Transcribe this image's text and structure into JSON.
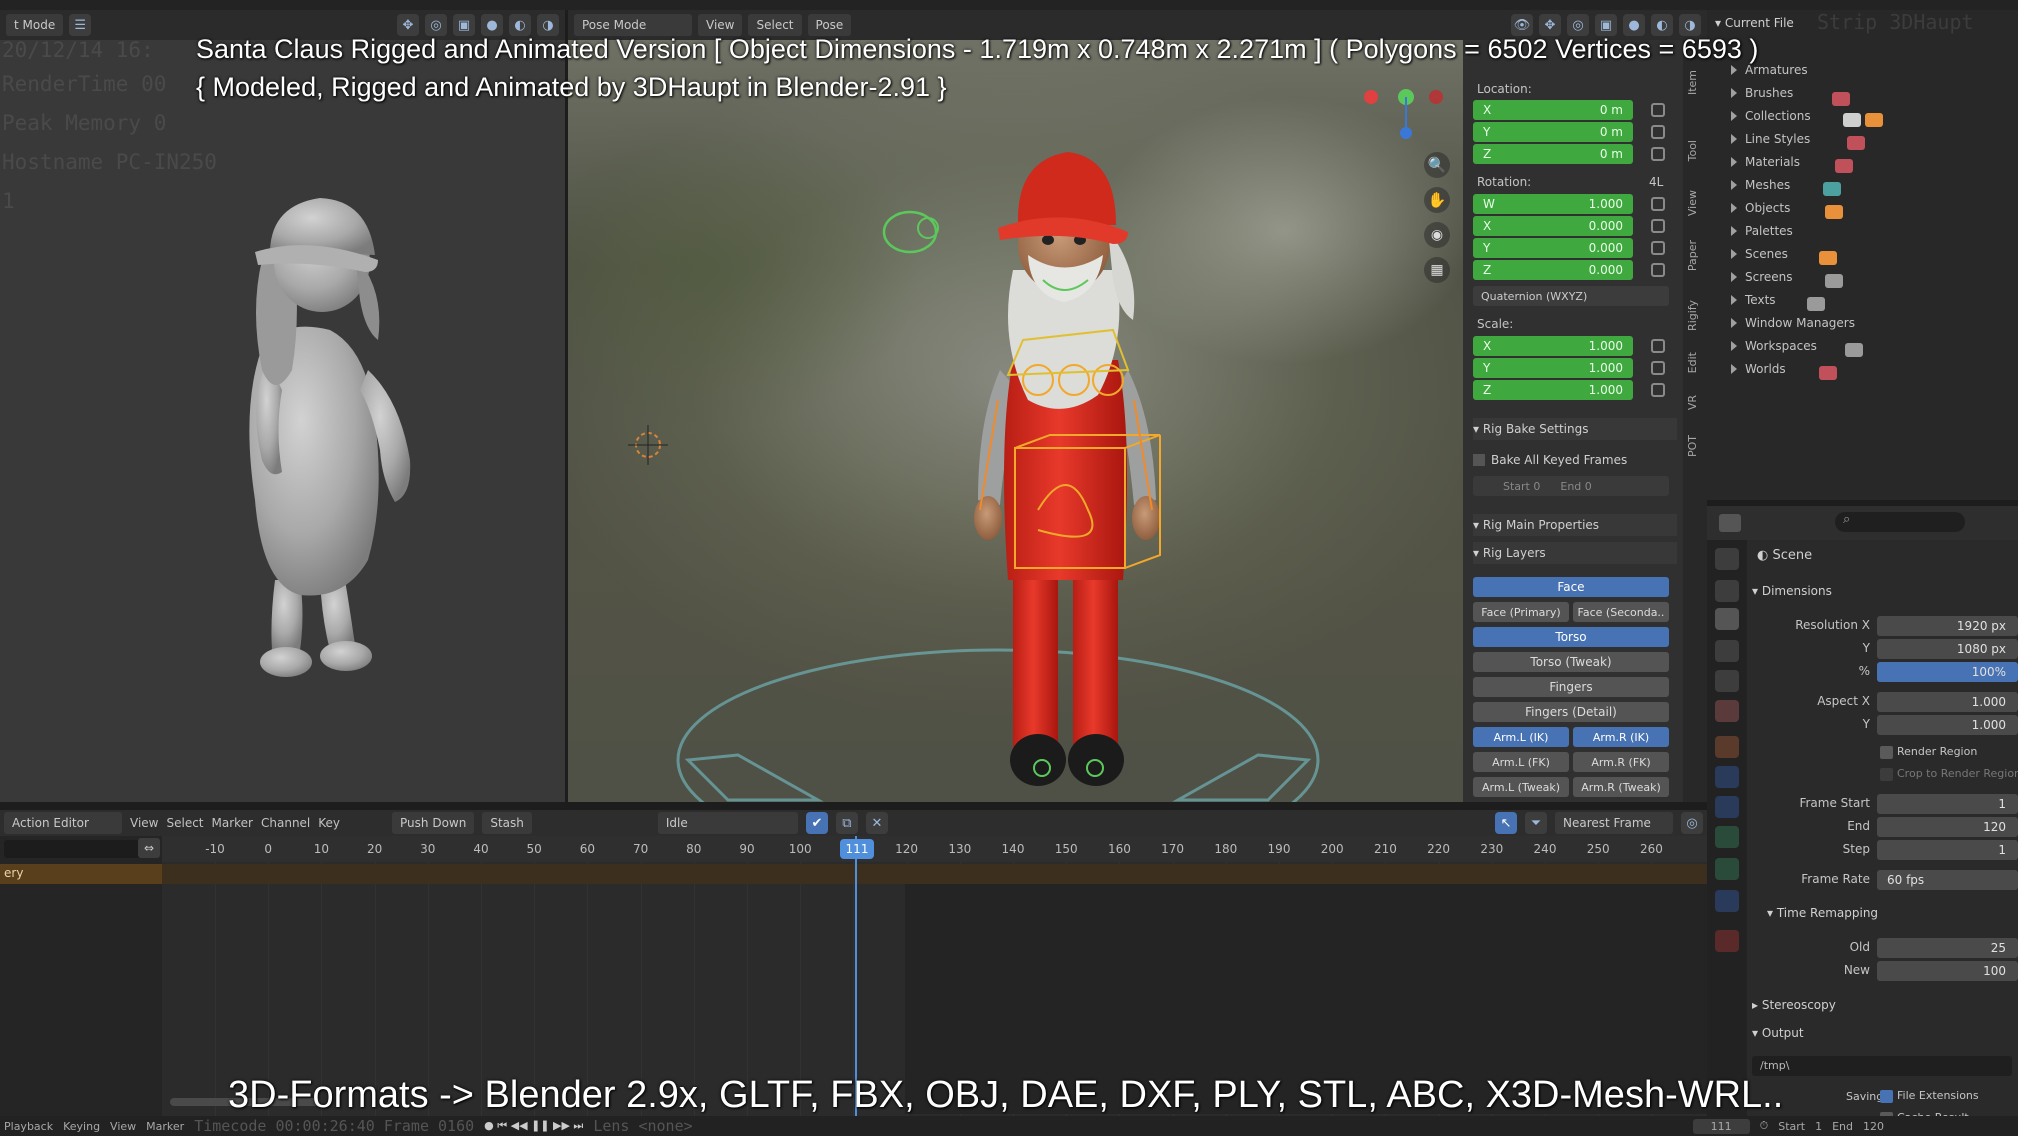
{
  "captions": {
    "title_line": "Santa Claus Rigged and Animated Version [ Object Dimensions -  1.719m x 0.748m x 2.271m ] ( Polygons = 6502  Vertices = 6593 )",
    "credit_line": "{ Modeled, Rigged and Animated by 3DHaupt in Blender-2.91 }",
    "formats_line": "3D-Formats -> Blender 2.9x, GLTF, FBX, OBJ, DAE, DXF, PLY, STL, ABC, X3D-Mesh-WRL.."
  },
  "left_view": {
    "mode_label": "t Mode",
    "stamp_lines": [
      "20/12/14 16:",
      "RenderTime 00",
      "Peak Memory 0",
      "Hostname PC-IN250",
      "1"
    ],
    "timecode": "Timecode 00:00:26:40   Frame 0160"
  },
  "viewport_header": {
    "mode": "Pose Mode",
    "menu": [
      "View",
      "Select",
      "Pose"
    ]
  },
  "npanel": {
    "location_label": "Location:",
    "location": [
      {
        "axis": "X",
        "value": "0 m"
      },
      {
        "axis": "Y",
        "value": "0 m"
      },
      {
        "axis": "Z",
        "value": "0 m"
      }
    ],
    "rotation_label": "Rotation:",
    "rotation_mode_short": "4L",
    "rotation": [
      {
        "axis": "W",
        "value": "1.000"
      },
      {
        "axis": "X",
        "value": "0.000"
      },
      {
        "axis": "Y",
        "value": "0.000"
      },
      {
        "axis": "Z",
        "value": "0.000"
      }
    ],
    "rotation_mode": "Quaternion (WXYZ)",
    "scale_label": "Scale:",
    "scale": [
      {
        "axis": "X",
        "value": "1.000"
      },
      {
        "axis": "Y",
        "value": "1.000"
      },
      {
        "axis": "Z",
        "value": "1.000"
      }
    ],
    "rig_bake": "Rig Bake Settings",
    "bake_all": "Bake All Keyed Frames",
    "bake_start": "Start   0",
    "bake_end": "End   0",
    "rig_main": "Rig Main Properties",
    "rig_layers": "Rig Layers",
    "layers": {
      "face": "Face",
      "face_primary": "Face (Primary)",
      "face_secondary": "Face (Seconda..",
      "torso": "Torso",
      "torso_tweak": "Torso (Tweak)",
      "fingers": "Fingers",
      "fingers_detail": "Fingers (Detail)",
      "arm_l_ik": "Arm.L (IK)",
      "arm_r_ik": "Arm.R (IK)",
      "arm_l_fk": "Arm.L (FK)",
      "arm_r_fk": "Arm.R (FK)",
      "arm_l_tweak": "Arm.L (Tweak)",
      "arm_r_tweak": "Arm.R (Tweak)"
    },
    "tabs": [
      "Item",
      "Tool",
      "View",
      "Paper",
      "Rigify",
      "Edit",
      "VR",
      "POT"
    ]
  },
  "outliner": {
    "header": "Current File",
    "ghost": "Strip 3DHaupt",
    "items": [
      "Armatures",
      "Brushes",
      "Collections",
      "Line Styles",
      "Materials",
      "Meshes",
      "Objects",
      "Palettes",
      "Scenes",
      "Screens",
      "Texts",
      "Window Managers",
      "Workspaces",
      "Worlds"
    ]
  },
  "properties": {
    "scene": "Scene",
    "dimensions": "Dimensions",
    "resolution_x_label": "Resolution X",
    "resolution_x": "1920 px",
    "y_label": "Y",
    "resolution_y": "1080 px",
    "pct_label": "%",
    "percent": "100%",
    "aspect_x_label": "Aspect X",
    "aspect_x": "1.000",
    "aspect_y": "1.000",
    "render_region": "Render Region",
    "crop": "Crop to Render Region",
    "frame_start_label": "Frame Start",
    "frame_start": "1",
    "end_label": "End",
    "frame_end": "120",
    "step_label": "Step",
    "frame_step": "1",
    "frame_rate_label": "Frame Rate",
    "frame_rate": "60 fps",
    "time_remapping": "Time Remapping",
    "old_label": "Old",
    "old": "25",
    "new_label": "New",
    "new": "100",
    "stereoscopy": "Stereoscopy",
    "output": "Output",
    "output_path": "/tmp\\",
    "saving": "Saving",
    "file_extensions": "File Extensions",
    "cache_result": "Cache Result"
  },
  "dopesheet": {
    "editor": "Action Editor",
    "menu": [
      "View",
      "Select",
      "Marker",
      "Channel",
      "Key"
    ],
    "push_down": "Push Down",
    "stash": "Stash",
    "action_name": "Idle",
    "snap": "Nearest Frame",
    "channel_label": "ery",
    "ruler": [
      "-10",
      "0",
      "10",
      "20",
      "30",
      "40",
      "50",
      "60",
      "70",
      "80",
      "90",
      "100",
      "110",
      "120",
      "130",
      "140",
      "150",
      "160",
      "170",
      "180",
      "190",
      "200",
      "210",
      "220",
      "230",
      "240",
      "250",
      "260"
    ],
    "current_frame": "111"
  },
  "statusbar": {
    "playback": "Playback",
    "keying": "Keying",
    "view": "View",
    "marker": "Marker",
    "frame": "111",
    "start_label": "Start",
    "start": "1",
    "end_label": "End",
    "end": "120",
    "lens": "Lens <none>"
  }
}
